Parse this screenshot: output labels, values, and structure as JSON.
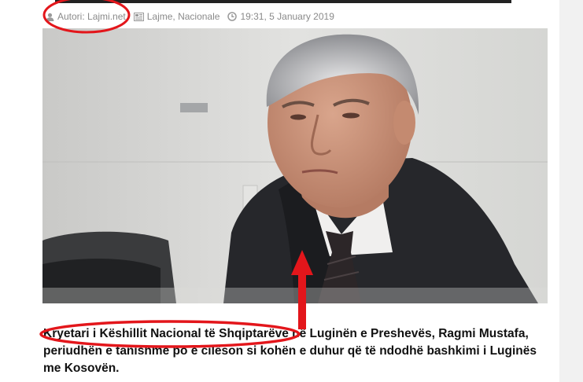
{
  "meta": {
    "author": "Autori: Lajmi.net",
    "categories": "Lajme, Nacionale",
    "datetime": "19:31, 5 January 2019",
    "author_icon": "user-icon",
    "category_icon": "newspaper-icon",
    "time_icon": "clock-icon"
  },
  "article": {
    "headline": "Kryetari i Këshillit Nacional të Shqiptarëve në Luginën e Preshevës, Ragmi Mustafa, periudhën e tanishme po e cilëson si kohën e duhur që të ndodhë bashkimi i Luginës me Kosovën."
  },
  "annotations": {
    "color": "#e3161b"
  }
}
